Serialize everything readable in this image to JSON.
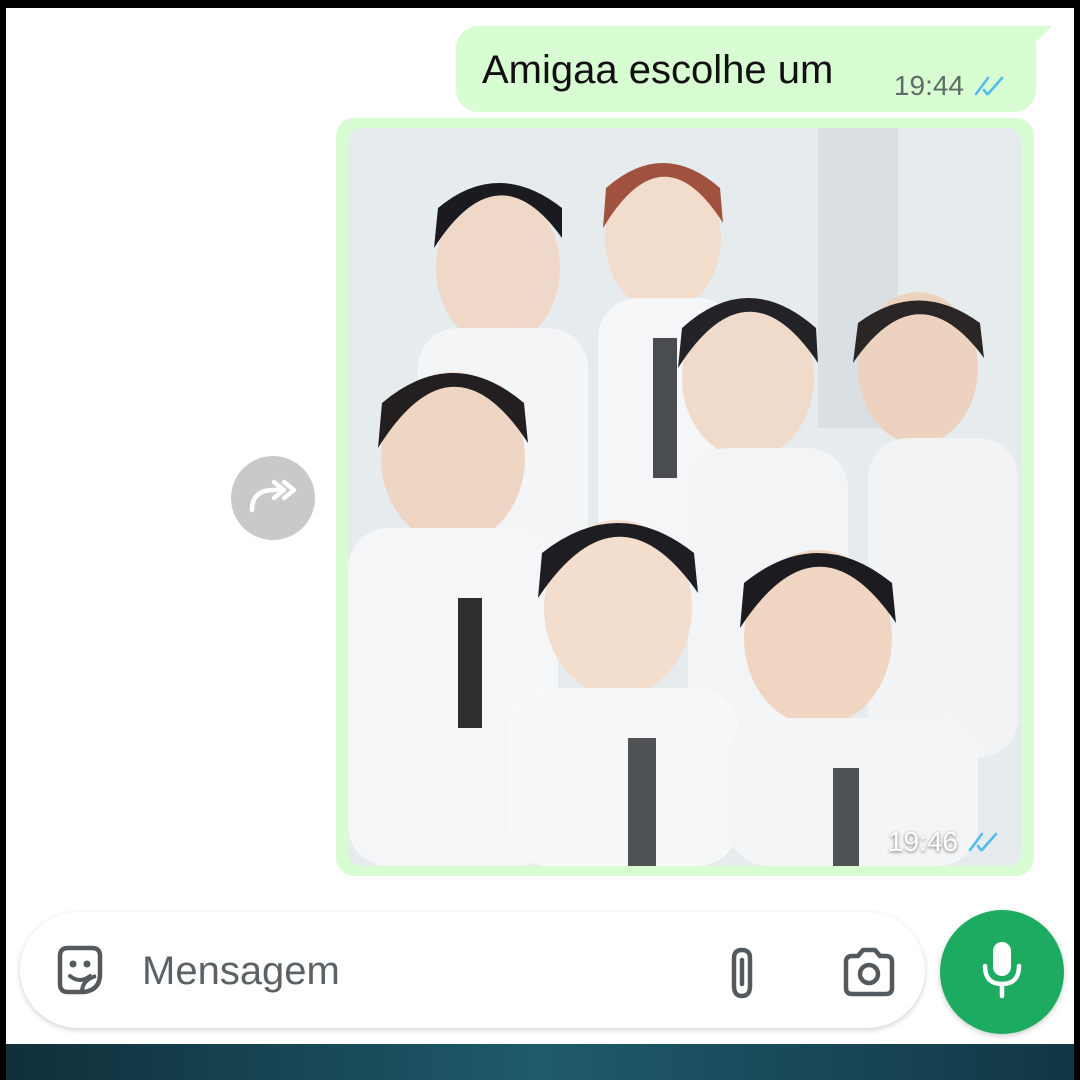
{
  "conversation": {
    "messages": [
      {
        "type": "text",
        "text": "Amigaa escolhe um",
        "time": "19:44",
        "status": "read"
      },
      {
        "type": "image",
        "time": "19:46",
        "status": "read",
        "description": "group photo"
      }
    ]
  },
  "composer": {
    "placeholder": "Mensagem",
    "icons": [
      "sticker-icon",
      "paperclip-icon",
      "camera-icon",
      "microphone-icon"
    ]
  },
  "actions": {
    "forward_icon": "forward-icon"
  },
  "colors": {
    "outgoing_bubble": "#d9fdd3",
    "read_ticks": "#53bdeb",
    "mic_button": "#1daa61"
  }
}
